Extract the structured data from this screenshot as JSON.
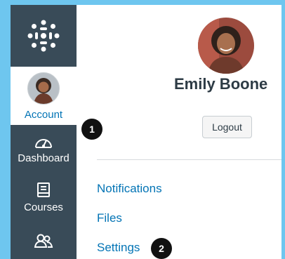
{
  "nav": {
    "account_label": "Account",
    "dashboard_label": "Dashboard",
    "courses_label": "Courses"
  },
  "profile": {
    "name": "Emily Boone",
    "logout_label": "Logout"
  },
  "links": {
    "notifications": "Notifications",
    "files": "Files",
    "settings": "Settings"
  },
  "callouts": {
    "one": "1",
    "two": "2"
  },
  "colors": {
    "nav_bg": "#394b58",
    "accent": "#0374b5",
    "page_bg": "#6ec6ef"
  }
}
